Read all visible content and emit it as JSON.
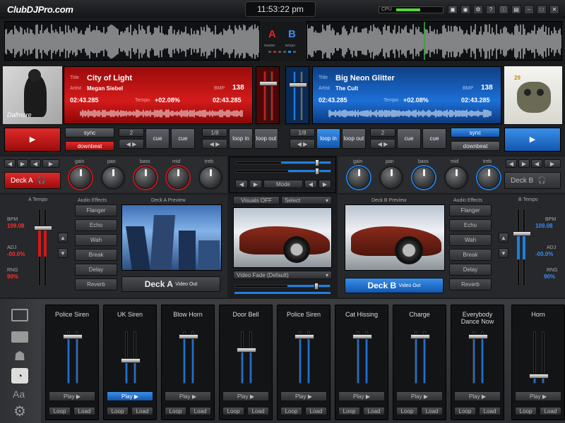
{
  "app": {
    "logo": "ClubDJPro.com",
    "clock": "11:53:22 pm",
    "cpu_label": "CPU"
  },
  "colors": {
    "deck_a": "#c41818",
    "deck_b": "#1f6fd0",
    "bg": "#1b1c1e"
  },
  "center": {
    "deck_a_letter": "A",
    "deck_b_letter": "B",
    "deck_a_sub": "master",
    "deck_b_sub": "tempo"
  },
  "deck_a": {
    "title_label": "Title",
    "title": "City of Light",
    "artist_label": "Artist",
    "artist": "Megan Siebel",
    "bpm_label": "BMP",
    "bpm": "138",
    "time_left": "02:43.285",
    "tempo_label": "Tempo",
    "tempo": "+02.08%",
    "time_right": "02:43.285",
    "album_text": "Dafmore",
    "sync": "sync",
    "downbeat": "downbeat",
    "cue_num": "2",
    "cue1": "cue",
    "cue2": "cue",
    "loop_num": "1/8",
    "loop_in": "loop in",
    "loop_out": "loop out",
    "deck_label": "Deck A",
    "knobs": [
      "gain",
      "pan",
      "bass",
      "mid",
      "treb"
    ],
    "tempo_header": "A Tempo",
    "bpm_small": "BPM",
    "bpm_val": "109.08",
    "adj_label": "ADJ",
    "adj_val": "-00.0%",
    "ring_label": "RNG",
    "ring_val": "90%",
    "effects_header": "Audio Effects",
    "effects": [
      "Flanger",
      "Echo",
      "Wah",
      "Break",
      "Delay",
      "Reverb"
    ],
    "preview_header": "Deck A Preview",
    "video_out": "Video Out"
  },
  "deck_b": {
    "title_label": "Title",
    "title": "Big Neon Glitter",
    "artist_label": "Artist",
    "artist": "The Cult",
    "bpm_label": "BMP",
    "bpm": "138",
    "time_left": "02:43.285",
    "tempo_label": "Tempo",
    "tempo": "+02.08%",
    "time_right": "02:43.285",
    "album_text": "29",
    "sync": "sync",
    "downbeat": "downbeat",
    "cue_num": "2",
    "cue1": "cue",
    "cue2": "cue",
    "loop_num": "1/8",
    "loop_in": "loop in",
    "loop_out": "loop out",
    "deck_label": "Deck B",
    "knobs": [
      "gain",
      "pan",
      "bass",
      "mid",
      "treb"
    ],
    "tempo_header": "B Tempo",
    "bpm_small": "BPM",
    "bpm_val": "109.08",
    "adj_label": "ADJ",
    "adj_val": "-00.0%",
    "ring_label": "RNG",
    "ring_val": "90%",
    "effects_header": "Audio Effects",
    "effects": [
      "Flanger",
      "Echo",
      "Wah",
      "Break",
      "Delay",
      "Reverb"
    ],
    "preview_header": "Deck B Preview",
    "video_out": "Video Out"
  },
  "mixer": {
    "mode_btn": "Mode",
    "visuals": "Visuals OFF",
    "select": "Select",
    "video_fade": "Video Fade (Default)"
  },
  "sampler": {
    "pads": [
      {
        "name": "Police Siren",
        "play": "Play ▶",
        "loop": "Loop",
        "load": "Load",
        "level": 0.9,
        "active": false
      },
      {
        "name": "UK Siren",
        "play": "Play ▶",
        "loop": "Loop",
        "load": "Load",
        "level": 0.45,
        "active": true
      },
      {
        "name": "Blow Horn",
        "play": "Play ▶",
        "loop": "Loop",
        "load": "Load",
        "level": 0.9,
        "active": false
      },
      {
        "name": "Door Bell",
        "play": "Play ▶",
        "loop": "Loop",
        "load": "Load",
        "level": 0.65,
        "active": false
      },
      {
        "name": "Police Siren",
        "play": "Play ▶",
        "loop": "Loop",
        "load": "Load",
        "level": 0.9,
        "active": false
      },
      {
        "name": "Cat Hissing",
        "play": "Play ▶",
        "loop": "Loop",
        "load": "Load",
        "level": 0.9,
        "active": false
      },
      {
        "name": "Charge",
        "play": "Play ▶",
        "loop": "Loop",
        "load": "Load",
        "level": 0.9,
        "active": false
      },
      {
        "name": "Everybody Dance Now",
        "play": "Play ▶",
        "loop": "Loop",
        "load": "Load",
        "level": 0.9,
        "active": false
      },
      {
        "name": "Horn",
        "play": "Play ▶",
        "loop": "Loop",
        "load": "Load",
        "level": 0.15,
        "active": false
      }
    ]
  }
}
